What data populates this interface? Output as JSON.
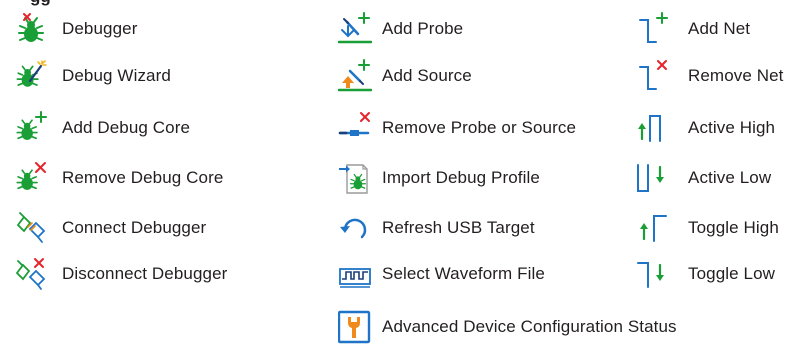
{
  "title_fragment": "gg",
  "colors": {
    "green": "#1a9e36",
    "red": "#e4252c",
    "blue": "#1f74c7",
    "dark_blue": "#1c3f7a",
    "orange": "#f08a1c",
    "text": "#231f20"
  },
  "items": [
    {
      "label": "Debugger",
      "icon": "debugger-icon"
    },
    {
      "label": "Debug Wizard",
      "icon": "debug-wizard-icon"
    },
    {
      "label": "Add Debug Core",
      "icon": "add-debug-core-icon"
    },
    {
      "label": "Remove Debug Core",
      "icon": "remove-debug-core-icon"
    },
    {
      "label": "Connect Debugger",
      "icon": "connect-debugger-icon"
    },
    {
      "label": "Disconnect Debugger",
      "icon": "disconnect-debugger-icon"
    },
    {
      "label": "Add Probe",
      "icon": "add-probe-icon"
    },
    {
      "label": "Add Source",
      "icon": "add-source-icon"
    },
    {
      "label": "Remove Probe or Source",
      "icon": "remove-probe-icon"
    },
    {
      "label": "Import Debug Profile",
      "icon": "import-debug-profile-icon"
    },
    {
      "label": "Refresh USB Target",
      "icon": "refresh-icon"
    },
    {
      "label": "Select Waveform File",
      "icon": "waveform-file-icon"
    },
    {
      "label": "Advanced Device Configuration Status",
      "icon": "device-config-icon"
    },
    {
      "label": "Add Net",
      "icon": "add-net-icon"
    },
    {
      "label": "Remove Net",
      "icon": "remove-net-icon"
    },
    {
      "label": "Active High",
      "icon": "active-high-icon"
    },
    {
      "label": "Active Low",
      "icon": "active-low-icon"
    },
    {
      "label": "Toggle High",
      "icon": "toggle-high-icon"
    },
    {
      "label": "Toggle Low",
      "icon": "toggle-low-icon"
    }
  ]
}
